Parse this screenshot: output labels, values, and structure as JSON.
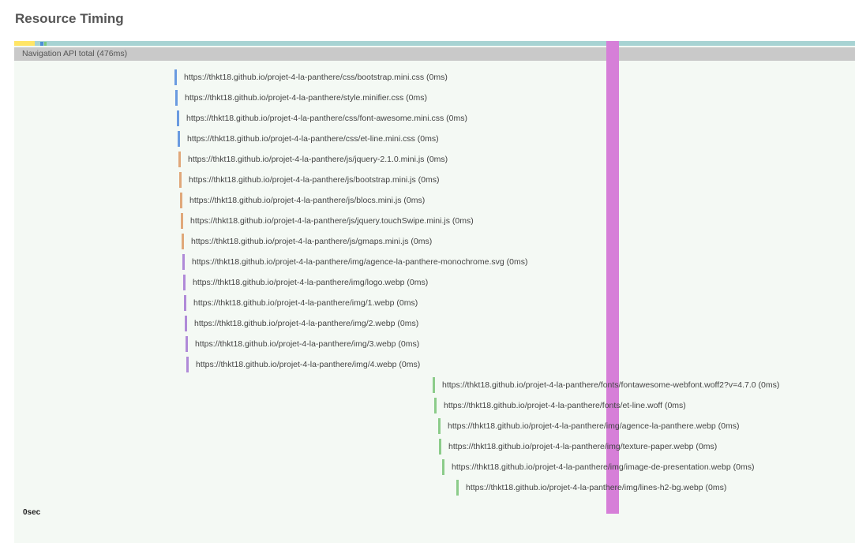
{
  "page": {
    "title": "Resource Timing"
  },
  "navigation": {
    "label": "Navigation API total (476ms)"
  },
  "axis": {
    "start_label": "0sec"
  },
  "colors": {
    "css": "#6a9be0",
    "js": "#e0a87a",
    "img": "#b08ad8",
    "font_and_late": "#8ccc8a",
    "load_marker": "#d67fd8"
  },
  "resources": [
    {
      "url": "https://thkt18.github.io/projet-4-la-panthere/css/bootstrap.mini.css (0ms)",
      "type": "css"
    },
    {
      "url": "https://thkt18.github.io/projet-4-la-panthere/style.minifier.css (0ms)",
      "type": "css"
    },
    {
      "url": "https://thkt18.github.io/projet-4-la-panthere/css/font-awesome.mini.css (0ms)",
      "type": "css"
    },
    {
      "url": "https://thkt18.github.io/projet-4-la-panthere/css/et-line.mini.css (0ms)",
      "type": "css"
    },
    {
      "url": "https://thkt18.github.io/projet-4-la-panthere/js/jquery-2.1.0.mini.js (0ms)",
      "type": "js"
    },
    {
      "url": "https://thkt18.github.io/projet-4-la-panthere/js/bootstrap.mini.js (0ms)",
      "type": "js"
    },
    {
      "url": "https://thkt18.github.io/projet-4-la-panthere/js/blocs.mini.js (0ms)",
      "type": "js"
    },
    {
      "url": "https://thkt18.github.io/projet-4-la-panthere/js/jquery.touchSwipe.mini.js (0ms)",
      "type": "js"
    },
    {
      "url": "https://thkt18.github.io/projet-4-la-panthere/js/gmaps.mini.js (0ms)",
      "type": "js"
    },
    {
      "url": "https://thkt18.github.io/projet-4-la-panthere/img/agence-la-panthere-monochrome.svg (0ms)",
      "type": "img"
    },
    {
      "url": "https://thkt18.github.io/projet-4-la-panthere/img/logo.webp (0ms)",
      "type": "img"
    },
    {
      "url": "https://thkt18.github.io/projet-4-la-panthere/img/1.webp (0ms)",
      "type": "img"
    },
    {
      "url": "https://thkt18.github.io/projet-4-la-panthere/img/2.webp (0ms)",
      "type": "img"
    },
    {
      "url": "https://thkt18.github.io/projet-4-la-panthere/img/3.webp (0ms)",
      "type": "img"
    },
    {
      "url": "https://thkt18.github.io/projet-4-la-panthere/img/4.webp (0ms)",
      "type": "img"
    },
    {
      "url": "https://thkt18.github.io/projet-4-la-panthere/fonts/fontawesome-webfont.woff2?v=4.7.0 (0ms)",
      "type": "font"
    },
    {
      "url": "https://thkt18.github.io/projet-4-la-panthere/fonts/et-line.woff (0ms)",
      "type": "font"
    },
    {
      "url": "https://thkt18.github.io/projet-4-la-panthere/img/agence-la-panthere.webp (0ms)",
      "type": "late"
    },
    {
      "url": "https://thkt18.github.io/projet-4-la-panthere/img/texture-paper.webp (0ms)",
      "type": "late"
    },
    {
      "url": "https://thkt18.github.io/projet-4-la-panthere/img/image-de-presentation.webp (0ms)",
      "type": "late"
    },
    {
      "url": "https://thkt18.github.io/projet-4-la-panthere/img/lines-h2-bg.webp (0ms)",
      "type": "late"
    }
  ]
}
